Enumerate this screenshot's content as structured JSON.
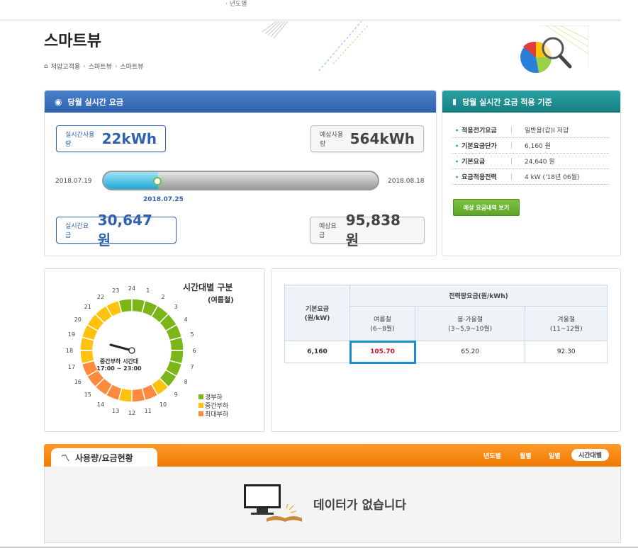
{
  "top_nav": {
    "item": "· 년도별"
  },
  "page": {
    "title": "스마트뷰",
    "breadcrumb": [
      "저압고객용",
      "스마트뷰",
      "스마트뷰"
    ]
  },
  "realtime": {
    "header": "당월 실시간 요금",
    "usage_label": "실시간사용량",
    "usage_value": "22kWh",
    "expected_usage_label": "예상사용량",
    "expected_usage_value": "564kWh",
    "start_date": "2018.07.19",
    "end_date": "2018.08.18",
    "current_date": "2018.07.25",
    "progress_fraction": 0.2,
    "fee_label": "실시간요금",
    "fee_value": "30,647 원",
    "expected_fee_label": "예상요금",
    "expected_fee_value": "95,838 원"
  },
  "criteria": {
    "header": "당월 실시간 요금 적용 기준",
    "rows": [
      {
        "key": "적용전기요금",
        "value": "일반용(갑)Ⅰ 저압"
      },
      {
        "key": "기본요금단가",
        "value": "6,160 원"
      },
      {
        "key": "기본요금",
        "value": "24,640 원"
      },
      {
        "key": "요금적용전력",
        "value": "4 kW ('18년 06월)"
      }
    ],
    "button": "예상 요금내역 보기"
  },
  "clock": {
    "title": "시간대별 구분",
    "season": "(여름철)",
    "center_label": "중간부하 시간대",
    "center_time": "17:00 ~ 23:00",
    "hours": [
      "1",
      "2",
      "3",
      "4",
      "5",
      "6",
      "7",
      "8",
      "9",
      "10",
      "11",
      "12",
      "13",
      "14",
      "15",
      "16",
      "17",
      "18",
      "19",
      "20",
      "21",
      "22",
      "23",
      "24"
    ],
    "legend": [
      {
        "label": "경부하",
        "color": "#7cb518"
      },
      {
        "label": "중간부하",
        "color": "#ffc20e"
      },
      {
        "label": "최대부하",
        "color": "#ff8a3d"
      }
    ]
  },
  "rate_table": {
    "base_header": "기본요금\n(원/kW)",
    "energy_header": "전력량요금(원/kWh)",
    "season_headers": [
      "여름철\n(6~8월)",
      "봄·가을철\n(3~5,9~10월)",
      "겨울철\n(11~12월)"
    ],
    "row": [
      "6,160",
      "105.70",
      "65.20",
      "92.30"
    ]
  },
  "usage": {
    "title": "사용량/요금현황",
    "tabs": [
      "년도별",
      "월별",
      "일별",
      "시간대별"
    ],
    "active_tab": "시간대별",
    "empty_message": "데이터가 없습니다"
  },
  "colors": {
    "blue": "#2f63b0",
    "teal": "#1a8b8e",
    "orange": "#f58300",
    "highlight": "#1a8fd0",
    "red_value": "#d0102a"
  }
}
